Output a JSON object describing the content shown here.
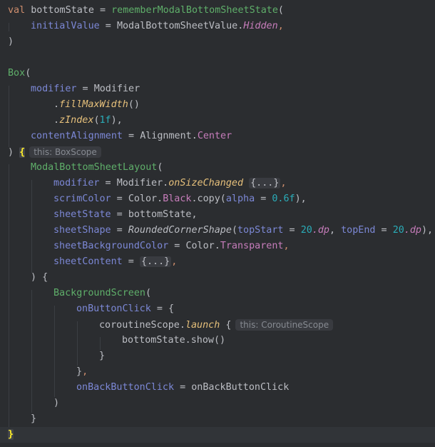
{
  "editor": {
    "language": "Kotlin",
    "theme": "dark",
    "colors": {
      "background": "#2b2d30",
      "keyword": "#cf8e6d",
      "function": "#56a8f5",
      "composable": "#5faf6a",
      "parameter": "#7c88d6",
      "property": "#c77dbb",
      "number": "#2aacb8",
      "inlay_hint": "#868a91"
    },
    "code": {
      "l1_val": "val",
      "l1_name": " bottomState",
      "l1_eq": " = ",
      "l1_fn": "rememberModalBottomSheetState",
      "l1_paren": "(",
      "l2_param": "initialValue",
      "l2_eq": " = ",
      "l2_type": "ModalBottomSheetValue.",
      "l2_value": "Hidden",
      "l2_comma": ",",
      "l3": ")",
      "l5_fn": "Box",
      "l5_paren": "(",
      "l6_param": "modifier",
      "l6_eq": " = ",
      "l6_obj": "Modifier",
      "l7_dot": ".",
      "l7_fn": "fillMaxWidth",
      "l7_args": "()",
      "l8_dot": ".",
      "l8_fn": "zIndex",
      "l8_open": "(",
      "l8_num": "1f",
      "l8_close": "),",
      "l9_param": "contentAlignment",
      "l9_eq": " = ",
      "l9_obj": "Alignment.",
      "l9_value": "Center",
      "l10_close": ") ",
      "l10_brace": "{",
      "l10_hint": "this: BoxScope",
      "l11_fn": "ModalBottomSheetLayout",
      "l11_paren": "(",
      "l12_param": "modifier",
      "l12_eq": " = ",
      "l12_obj": "Modifier.",
      "l12_fn": "onSizeChanged",
      "l12_fold": "{...}",
      "l12_comma": ",",
      "l13_param": "scrimColor",
      "l13_eq": " = ",
      "l13_obj": "Color.",
      "l13_prop": "Black",
      "l13_copy": ".copy(",
      "l13_arg": "alpha",
      "l13_argeq": " = ",
      "l13_num": "0.6f",
      "l13_close": "),",
      "l14_param": "sheetState",
      "l14_eq": " = ",
      "l14_value": "bottomState,",
      "l15_param": "sheetShape",
      "l15_eq": " = ",
      "l15_fn": "RoundedCornerShape",
      "l15_open": "(",
      "l15_arg1": "topStart",
      "l15_eq1": " = ",
      "l15_num1": "20",
      "l15_dp1": ".dp",
      "l15_sep": ", ",
      "l15_arg2": "topEnd",
      "l15_eq2": " = ",
      "l15_num2": "20",
      "l15_dp2": ".dp",
      "l15_close": "),",
      "l16_param": "sheetBackgroundColor",
      "l16_eq": " = ",
      "l16_obj": "Color.",
      "l16_prop": "Transparent",
      "l16_comma": ",",
      "l17_param": "sheetContent",
      "l17_eq": " = ",
      "l17_fold": "{...}",
      "l17_comma": ",",
      "l18": ") {",
      "l19_fn": "BackgroundScreen",
      "l19_paren": "(",
      "l20_param": "onButtonClick",
      "l20_rest": " = {",
      "l21_obj": "coroutineScope.",
      "l21_fn": "launch",
      "l21_brace": " {",
      "l21_hint": "this: CoroutineScope",
      "l22": "bottomState.show()",
      "l23": "}",
      "l24_close": "}",
      "l24_comma": ",",
      "l25_param": "onBackButtonClick",
      "l25_rest": " = onBackButtonClick",
      "l26": ")",
      "l27": "}",
      "l28": "}"
    }
  }
}
